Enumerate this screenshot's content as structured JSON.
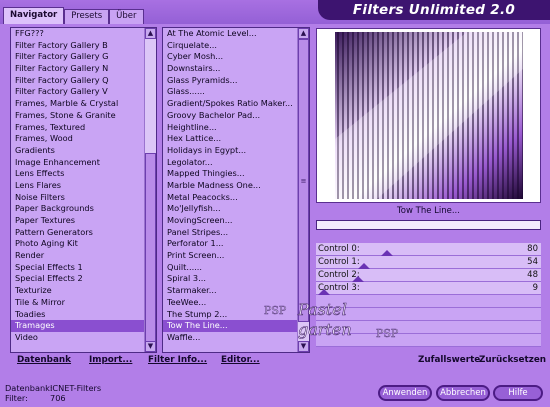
{
  "tabs": [
    {
      "label": "Navigator"
    },
    {
      "label": "Presets"
    },
    {
      "label": "Über"
    }
  ],
  "app_title": "Filters Unlimited 2.0",
  "categories": [
    "FFG???",
    "Filter Factory Gallery B",
    "Filter Factory Gallery G",
    "Filter Factory Gallery N",
    "Filter Factory Gallery Q",
    "Filter Factory Gallery V",
    "Frames, Marble & Crystal",
    "Frames, Stone & Granite",
    "Frames, Textured",
    "Frames, Wood",
    "Gradients",
    "Image Enhancement",
    "Lens Effects",
    "Lens Flares",
    "Noise Filters",
    "Paper Backgrounds",
    "Paper Textures",
    "Pattern Generators",
    "Photo Aging Kit",
    "Render",
    "Special Effects 1",
    "Special Effects 2",
    "Texturize",
    "Tile & Mirror",
    "Toadies",
    "Tramages",
    "Video"
  ],
  "categories_selected": "Tramages",
  "filters": [
    "At The Atomic Level...",
    "Cirquelate...",
    "Cyber Mosh...",
    "Downstairs...",
    "Glass Pyramids...",
    "Glass......",
    "Gradient/Spokes Ratio Maker...",
    "Groovy Bachelor Pad...",
    "Heightline...",
    "Hex Lattice...",
    "Holidays in Egypt...",
    "Legolator...",
    "Mapped Thingies...",
    "Marble Madness One...",
    "Metal Peacocks...",
    "Mo'Jellyfish...",
    "MovingScreen...",
    "Panel Stripes...",
    "Perforator 1...",
    "Print Screen...",
    "Quilt......",
    "Spiral 3...",
    "Starmaker...",
    "TeeWee...",
    "The Stump 2...",
    "Tow The Line...",
    "Waffle..."
  ],
  "filters_selected": "Tow The Line...",
  "preview_filter_name": "Tow The Line...",
  "progress": 0,
  "controls": [
    {
      "label": "Control 0:",
      "value": "80"
    },
    {
      "label": "Control 1:",
      "value": "54"
    },
    {
      "label": "Control 2:",
      "value": "48"
    },
    {
      "label": "Control 3:",
      "value": "9"
    }
  ],
  "control_max": 255,
  "watermark": {
    "line1": "Pastel",
    "line2": "garten"
  },
  "buttons": {
    "datenbank": "Datenbank",
    "import": "Import...",
    "filter_info": "Filter Info...",
    "editor": "Editor...",
    "zufallswerte": "Zufallswerte",
    "zuruecksetzen": "Zurücksetzen"
  },
  "status": {
    "datenbank_label": "Datenbank:",
    "datenbank_value": "ICNET-Filters",
    "filter_label": "Filter:",
    "filter_value": "706"
  },
  "actions": {
    "anwenden": "Anwenden",
    "abbrechen": "Abbrechen",
    "hilfe": "Hilfe"
  },
  "colors": {
    "background": "#b27ee8",
    "list_bg": "#c9a4f4",
    "selection": "#8a4fd0",
    "title_bar": "#3d1470",
    "button_fill": "#9760d6"
  }
}
